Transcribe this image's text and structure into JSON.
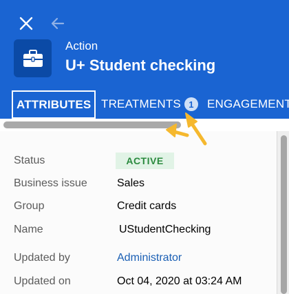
{
  "header": {
    "subtitle": "Action",
    "title": "U+ Student checking",
    "icons": {
      "close": "close-icon",
      "back": "back-arrow-icon",
      "case": "briefcase-icon"
    },
    "color": "#1a64d2"
  },
  "tabs": [
    {
      "label": "ATTRIBUTES",
      "selected": true
    },
    {
      "label": "TREATMENTS",
      "badge": "1"
    },
    {
      "label": "ENGAGEMENT"
    }
  ],
  "attributes": {
    "status": {
      "label": "Status",
      "value": "ACTIVE"
    },
    "business_issue": {
      "label": "Business issue",
      "value": "Sales"
    },
    "group": {
      "label": "Group",
      "value": "Credit cards"
    },
    "name": {
      "label": "Name",
      "value": "UStudentChecking"
    },
    "updated_by": {
      "label": "Updated by",
      "value": "Administrator"
    },
    "updated_on": {
      "label": "Updated on",
      "value": "Oct 04, 2020 at 03:24 AM"
    }
  },
  "annotation": {
    "icon": "arrow-pointer-icon",
    "color": "#f5b82e"
  }
}
